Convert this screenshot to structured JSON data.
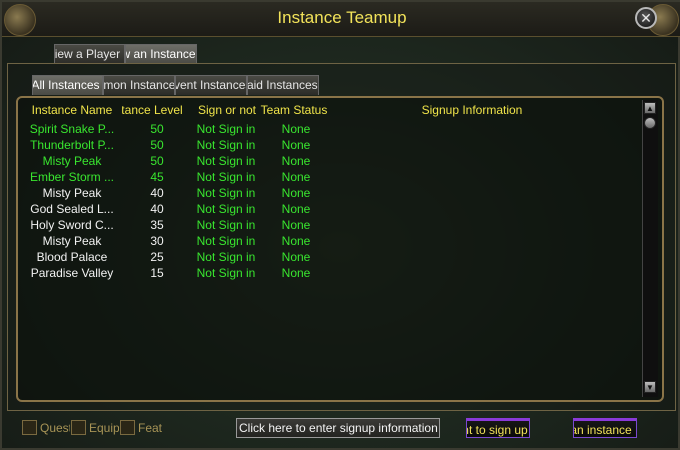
{
  "window": {
    "title": "Instance Teamup"
  },
  "outer_tabs": [
    {
      "label": "View a Player",
      "active": false
    },
    {
      "label": "View an Instance",
      "active": true
    }
  ],
  "sub_tabs": [
    {
      "label": "All Instances",
      "active": true
    },
    {
      "label": "Common Instances",
      "active": false
    },
    {
      "label": "Event Instances",
      "active": false
    },
    {
      "label": "Raid Instances",
      "active": false
    }
  ],
  "table": {
    "headers": [
      "Instance Name",
      "Instance Level",
      "Sign or not",
      "Team Status",
      "Signup Information"
    ],
    "rows": [
      {
        "name": "Spirit Snake P...",
        "level": "50",
        "sign": "Not Sign in",
        "status": "None",
        "available": true
      },
      {
        "name": "Thunderbolt P...",
        "level": "50",
        "sign": "Not Sign in",
        "status": "None",
        "available": true
      },
      {
        "name": "Misty Peak",
        "level": "50",
        "sign": "Not Sign in",
        "status": "None",
        "available": true
      },
      {
        "name": "Ember Storm ...",
        "level": "45",
        "sign": "Not Sign in",
        "status": "None",
        "available": true
      },
      {
        "name": "Misty Peak",
        "level": "40",
        "sign": "Not Sign in",
        "status": "None",
        "available": false
      },
      {
        "name": "God Sealed L...",
        "level": "40",
        "sign": "Not Sign in",
        "status": "None",
        "available": false
      },
      {
        "name": "Holy Sword C...",
        "level": "35",
        "sign": "Not Sign in",
        "status": "None",
        "available": false
      },
      {
        "name": "Misty Peak",
        "level": "30",
        "sign": "Not Sign in",
        "status": "None",
        "available": false
      },
      {
        "name": "Blood Palace",
        "level": "25",
        "sign": "Not Sign in",
        "status": "None",
        "available": false
      },
      {
        "name": "Paradise Valley",
        "level": "15",
        "sign": "Not Sign in",
        "status": "None",
        "available": false
      }
    ]
  },
  "filters": [
    {
      "label": "Quest",
      "checked": false
    },
    {
      "label": "Equip",
      "checked": false
    },
    {
      "label": "Feat",
      "checked": false
    }
  ],
  "buttons": {
    "signup_info": "Click here to enter signup information",
    "want_to_sign": "I want to sign up",
    "enter_instance": "Enter an instance"
  },
  "colors": {
    "header": "#f0e44a",
    "available": "#39e62f",
    "unavailable": "#f2f2f2",
    "accent_purple": "#8a3ad8"
  }
}
